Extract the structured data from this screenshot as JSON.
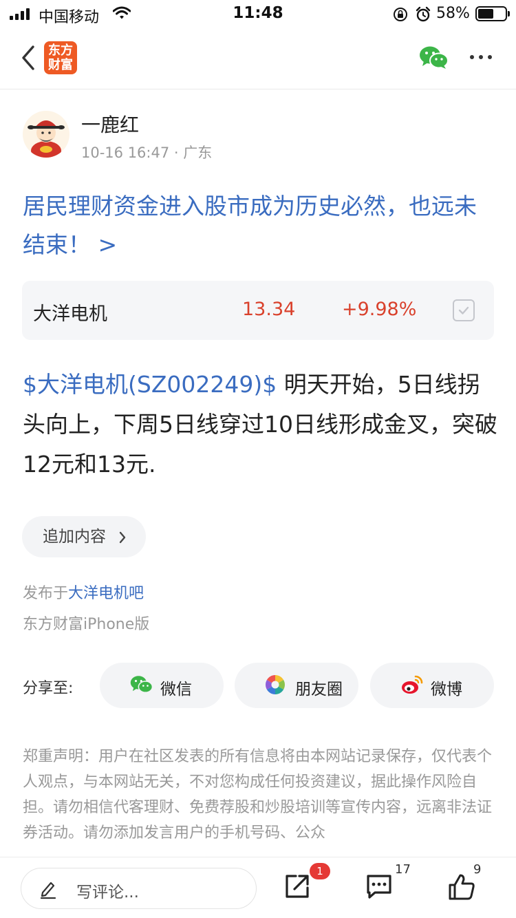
{
  "status_bar": {
    "carrier": "中国移动",
    "time": "11:48",
    "battery_percent": "58%",
    "battery_level": 0.58,
    "icons": [
      "signal-icon",
      "wifi-icon",
      "orientation-lock-icon",
      "alarm-icon",
      "battery-icon"
    ]
  },
  "nav": {
    "logo_line1": "东方",
    "logo_line2": "财富",
    "icons": [
      "back-icon",
      "wechat-icon",
      "more-icon"
    ],
    "brand_color": "#ee5a24"
  },
  "author": {
    "name": "一鹿红",
    "date": "10-16 16:47",
    "separator": "·",
    "location": "广东"
  },
  "headline": "居民理财资金进入股市成为历史必然，也远未结束！ >",
  "stock_card": {
    "name": "大洋电机",
    "price": "13.34",
    "change": "+9.98%",
    "up_color": "#d9412c"
  },
  "post": {
    "stock_tag": "$大洋电机(SZ002249)$",
    "text": " 明天开始，5日线拐头向上，下周5日线穿过10日线形成金叉，突破12元和13元."
  },
  "add_content": {
    "label": "追加内容"
  },
  "published": {
    "prefix": "发布于",
    "bar_name": "大洋电机吧",
    "client": "东方财富iPhone版"
  },
  "share": {
    "label": "分享至:",
    "wechat": "微信",
    "moments": "朋友圈",
    "weibo": "微博"
  },
  "disclaimer": "郑重声明：用户在社区发表的所有信息将由本网站记录保存，仅代表个人观点，与本网站无关，不对您构成任何投资建议，据此操作风险自担。请勿相信代客理财、免费荐股和炒股培训等宣传内容，远离非法证券活动。请勿添加发言用户的手机号码、公众",
  "bottom_bar": {
    "comment_placeholder": "写评论...",
    "share_badge": "1",
    "comment_count": "17",
    "like_count": "9"
  }
}
